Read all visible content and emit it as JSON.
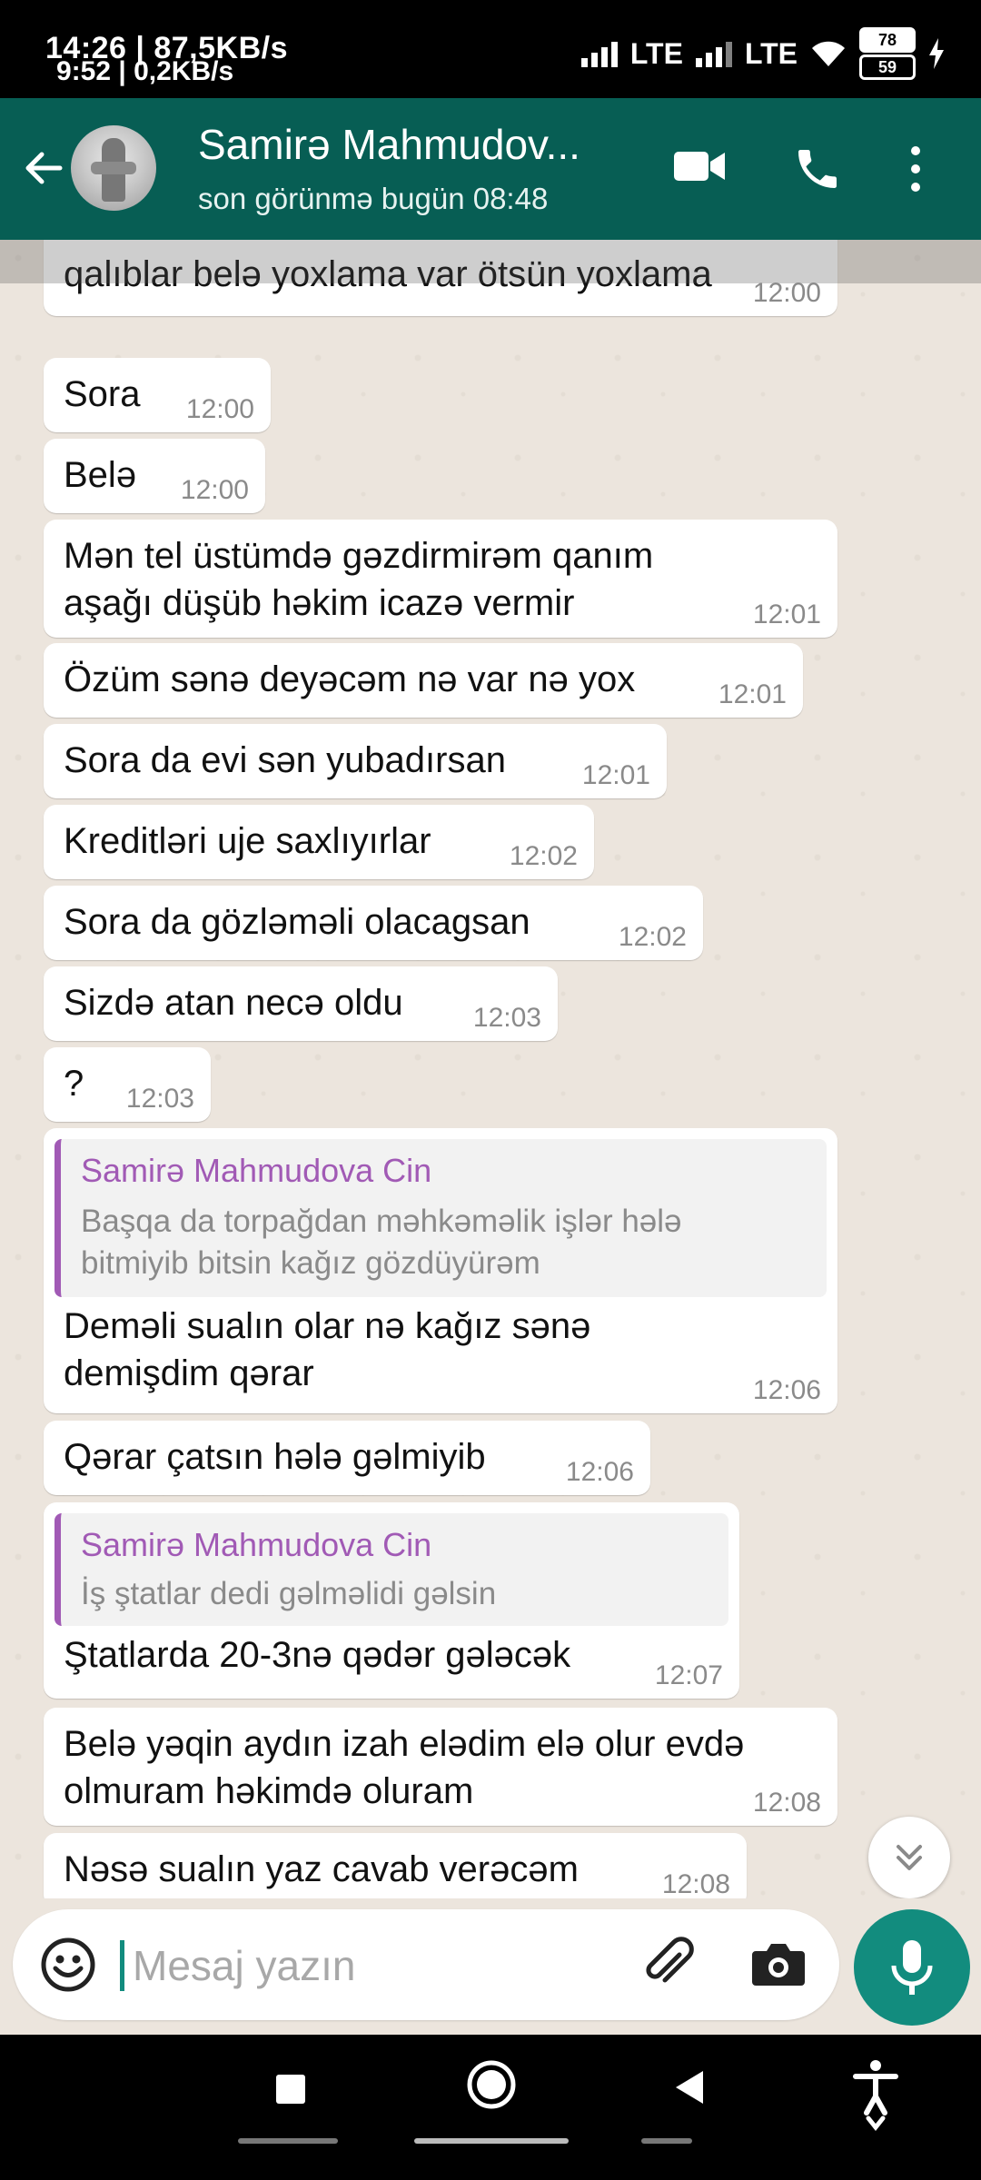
{
  "status_bar": {
    "time_primary": "14:26 | 87,5KB/s",
    "time_secondary": "9:52 | 0,2KB/s",
    "network1": "LTE",
    "network2": "LTE",
    "battery1": "78",
    "battery2": "59"
  },
  "header": {
    "contact_name": "Samirə Mahmudov...",
    "last_seen": "son görünmə bugün 08:48"
  },
  "messages": [
    {
      "text": "qalıblar belə yoxlama var ötsün yoxlama",
      "time": "12:00"
    },
    {
      "text": "Sora",
      "time": "12:00"
    },
    {
      "text": "Belə",
      "time": "12:00"
    },
    {
      "text": "Mən tel üstümdə gəzdirmirəm qanım\naşağı düşüb həkim icazə vermir",
      "time": "12:01"
    },
    {
      "text": "Özüm sənə deyəcəm nə var nə yox",
      "time": "12:01"
    },
    {
      "text": "Sora da evi sən yubadırsan",
      "time": "12:01"
    },
    {
      "text": "Kreditləri uje saxlıyırlar",
      "time": "12:02"
    },
    {
      "text": "Sora da gözləməli olacagsan",
      "time": "12:02"
    },
    {
      "text": "Sizdə atan necə oldu",
      "time": "12:03"
    },
    {
      "text": "?",
      "time": "12:03"
    },
    {
      "quote_name": "Samirə Mahmudova Cin",
      "quote_text": "Başqa da torpağdan məhkəməlik işlər hələ\nbitmiyib bitsin kağız gözdüyürəm",
      "text": "Deməli sualın olar nə kağız sənə\ndemişdim qərar",
      "time": "12:06"
    },
    {
      "text": "Qərar çatsın hələ gəlmiyib",
      "time": "12:06"
    },
    {
      "quote_name": "Samirə Mahmudova Cin",
      "quote_text": "İş ştatlar dedi gəlməlidi gəlsin",
      "text": "Ştatlarda 20-3nə qədər gələcək",
      "time": "12:07"
    },
    {
      "text": "Belə yəqin aydın izah elədim  elə olur evdə\nolmuram həkimdə oluram",
      "time": "12:08"
    },
    {
      "text": "Nəsə sualın yaz cavab verəcəm",
      "time": "12:08"
    }
  ],
  "input": {
    "placeholder": "Mesaj yazın"
  },
  "icons": [
    "back-arrow-icon",
    "video-call-icon",
    "phone-icon",
    "more-vert-icon",
    "emoji-icon",
    "attach-icon",
    "camera-icon",
    "mic-icon",
    "scroll-down-icon",
    "nav-recents-icon",
    "nav-home-icon",
    "nav-back-icon",
    "accessibility-icon"
  ],
  "colors": {
    "header": "#075e54",
    "accent": "#128c7e",
    "chat_bg": "#ece5dd",
    "bubble": "#ffffff",
    "quote_accent": "#a15ab5"
  }
}
